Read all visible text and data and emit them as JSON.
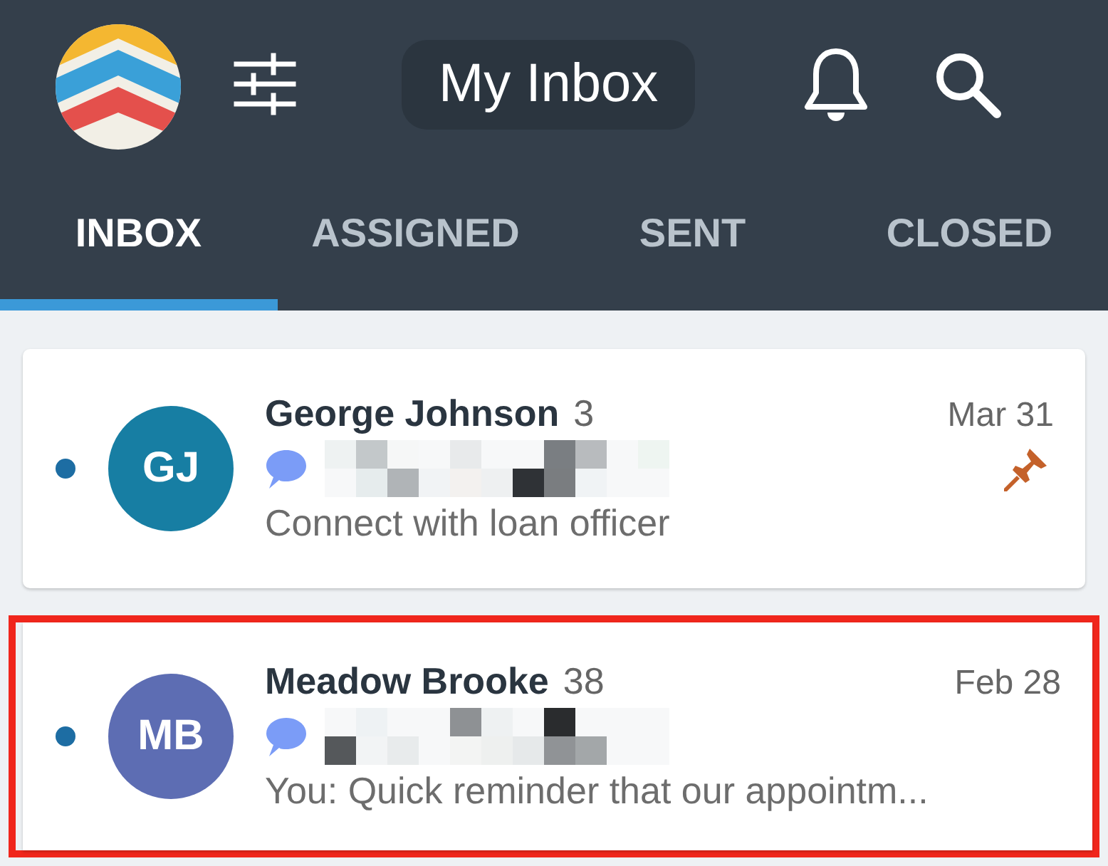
{
  "header": {
    "title": "My Inbox"
  },
  "tabs": [
    {
      "label": "INBOX",
      "selected": true
    },
    {
      "label": "ASSIGNED",
      "selected": false
    },
    {
      "label": "SENT",
      "selected": false
    },
    {
      "label": "CLOSED",
      "selected": false
    }
  ],
  "conversations": [
    {
      "initials": "GJ",
      "color": "#177ea3",
      "name": "George Johnson",
      "count": "3",
      "date": "Mar 31",
      "preview": "Connect with loan officer",
      "unread": true,
      "pinned": true,
      "highlighted": false
    },
    {
      "initials": "MB",
      "color": "#5d6db3",
      "name": "Meadow Brooke",
      "count": "38",
      "date": "Feb 28",
      "preview": "You: Quick reminder that our appointm...",
      "unread": true,
      "pinned": false,
      "highlighted": true
    }
  ]
}
